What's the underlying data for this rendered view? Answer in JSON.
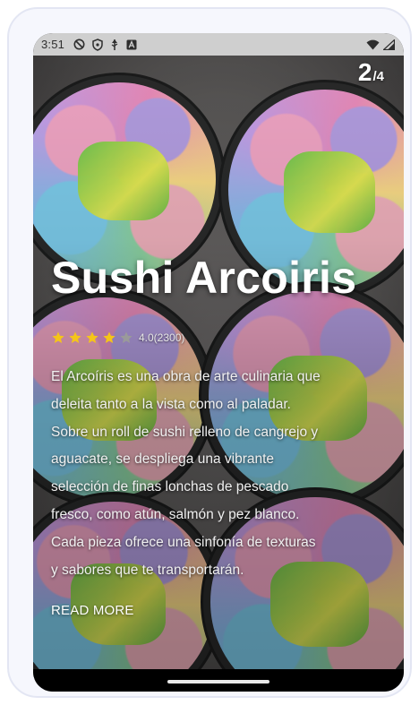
{
  "status_bar": {
    "time": "3:51",
    "left_icons": [
      "no-disturb-icon",
      "shield-icon",
      "usb-icon",
      "app-a-icon"
    ],
    "right_icons": [
      "wifi-icon",
      "signal-icon"
    ]
  },
  "counter": {
    "current": "2",
    "total": "/4"
  },
  "recipe": {
    "title": "Sushi Arcoiris",
    "rating_value": 4,
    "rating_max": 5,
    "rating_text": "4.0(2300)",
    "description_lines": [
      "El Arcoíris es una obra de arte culinaria que",
      "deleita tanto a la vista como al paladar.",
      "Sobre un roll de sushi relleno de cangrejo y",
      "aguacate, se despliega una vibrante",
      "selección de finas lonchas de pescado",
      "fresco, como atún, salmón y pez blanco.",
      "Cada pieza ofrece una sinfonía de texturas",
      "y sabores que te transportarán."
    ],
    "read_more": "READ MORE"
  },
  "colors": {
    "star_filled": "#f5c518",
    "star_empty": "#9a9a9a",
    "status_bar_bg": "#cfcfcf",
    "nav_bar_bg": "#000000"
  }
}
